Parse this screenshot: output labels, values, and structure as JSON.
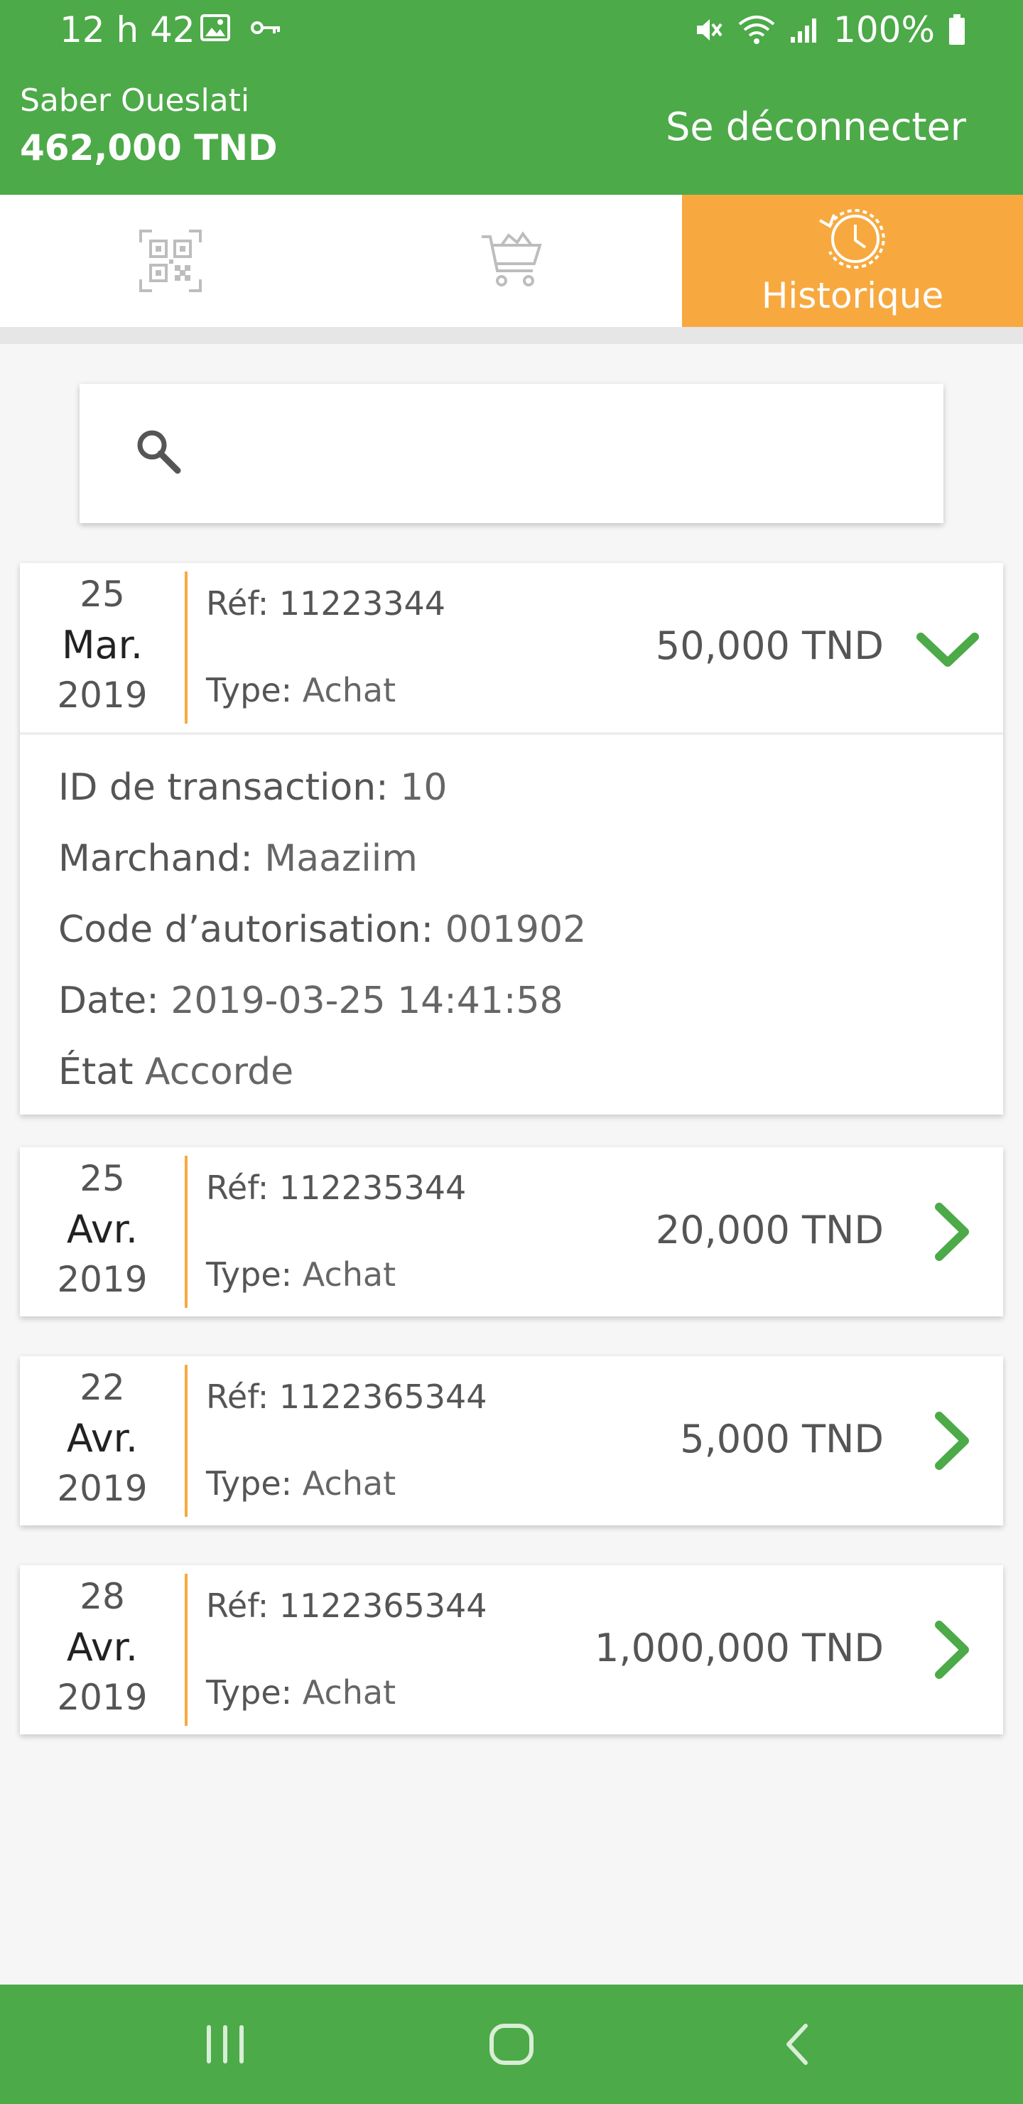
{
  "status_bar": {
    "time": "12 h 42",
    "battery": "100%",
    "icons": [
      "image-icon",
      "key-icon",
      "mute-icon",
      "wifi-icon",
      "signal-icon",
      "battery-icon"
    ]
  },
  "header": {
    "user_name": "Saber Oueslati",
    "balance": "462,000 TND",
    "logout_label": "Se déconnecter"
  },
  "tabs": {
    "qr_icon": "qr-code-icon",
    "cart_icon": "cart-icon",
    "history_label": "Historique",
    "history_icon": "history-icon",
    "active": "history"
  },
  "search": {
    "placeholder": "",
    "value": ""
  },
  "colors": {
    "primary": "#4caa48",
    "accent": "#f7a93f"
  },
  "transactions": [
    {
      "day": "25",
      "month": "Mar.",
      "year": "2019",
      "ref_label": "Réf:",
      "ref": "11223344",
      "type_label": "Type:",
      "type": "Achat",
      "amount": "50,000 TND",
      "expanded": true,
      "details": {
        "transaction_id_label": "ID de transaction:",
        "transaction_id": "10",
        "merchant_label": "Marchand:",
        "merchant": "Maaziim",
        "auth_code_label": "Code d’autorisation:",
        "auth_code": "001902",
        "date_label": "Date:",
        "date": "2019-03-25 14:41:58",
        "state_label": "État",
        "state": "Accorde"
      }
    },
    {
      "day": "25",
      "month": "Avr.",
      "year": "2019",
      "ref_label": "Réf:",
      "ref": "112235344",
      "type_label": "Type:",
      "type": "Achat",
      "amount": "20,000 TND",
      "expanded": false
    },
    {
      "day": "22",
      "month": "Avr.",
      "year": "2019",
      "ref_label": "Réf:",
      "ref": "1122365344",
      "type_label": "Type:",
      "type": "Achat",
      "amount": "5,000 TND",
      "expanded": false
    },
    {
      "day": "28",
      "month": "Avr.",
      "year": "2019",
      "ref_label": "Réf:",
      "ref": "1122365344",
      "type_label": "Type:",
      "type": "Achat",
      "amount": "1,000,000 TND",
      "expanded": false
    }
  ],
  "nav_bar": {
    "buttons": [
      "recent-apps-icon",
      "home-icon",
      "back-icon"
    ]
  }
}
